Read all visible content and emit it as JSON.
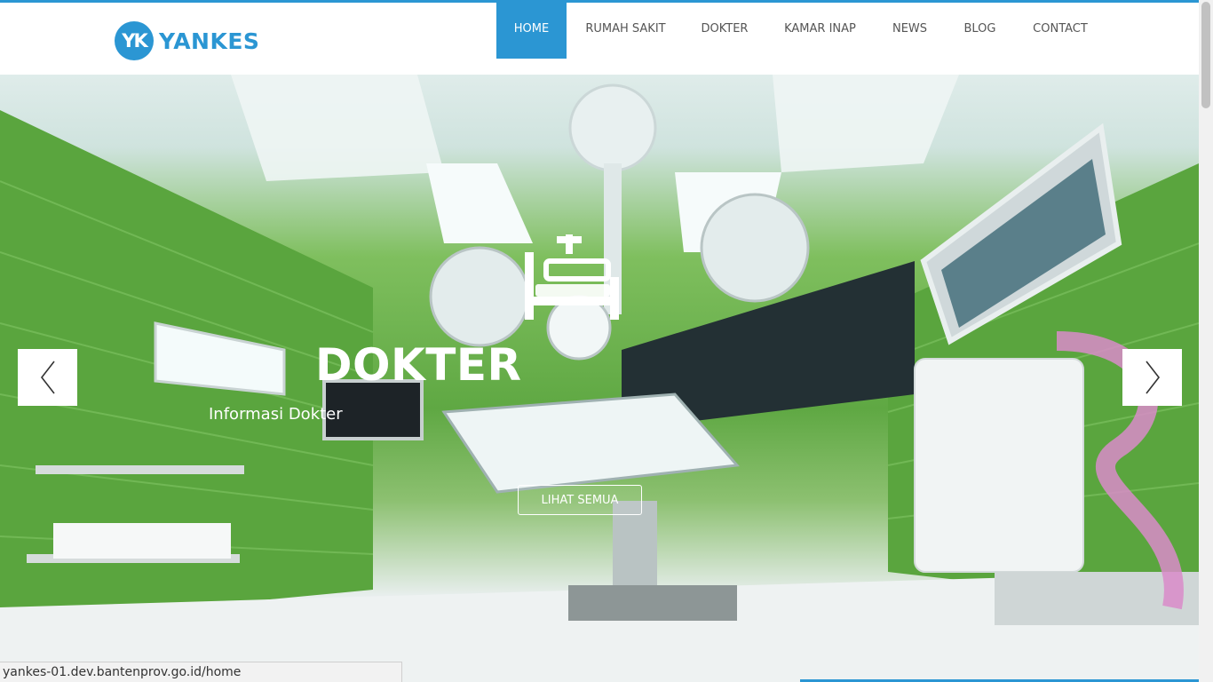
{
  "logo": {
    "badge": "YK",
    "name": "YANKES"
  },
  "nav": [
    {
      "label": "HOME",
      "active": true
    },
    {
      "label": "RUMAH SAKIT"
    },
    {
      "label": "DOKTER"
    },
    {
      "label": "KAMAR INAP"
    },
    {
      "label": "NEWS"
    },
    {
      "label": "BLOG"
    },
    {
      "label": "CONTACT"
    }
  ],
  "hero": {
    "icon": "hospital-bed-icon",
    "title": "DOKTER",
    "subtitle": "Informasi Dokter",
    "button_label": "LIHAT SEMUA",
    "prev_icon": "chevron-left-icon",
    "next_icon": "chevron-right-icon"
  },
  "status_bar": {
    "url": "yankes-01.dev.bantenprov.go.id/home"
  },
  "colors": {
    "brand": "#2b96d3",
    "wall": "#5fa843"
  }
}
